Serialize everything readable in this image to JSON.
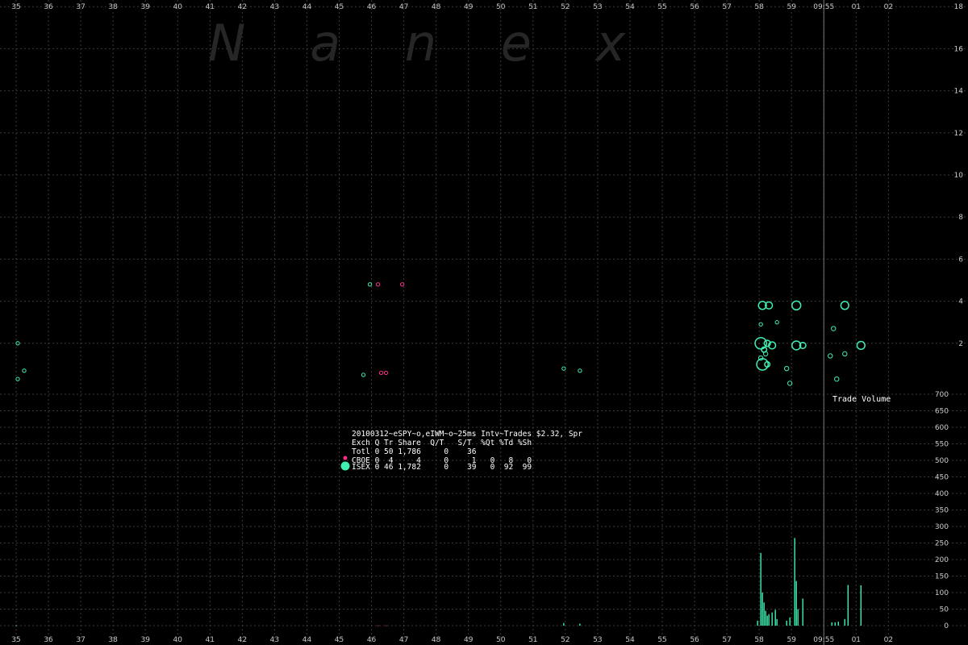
{
  "watermark": "N a n e x",
  "colors": {
    "background": "#000000",
    "grid": "#3a3a3a",
    "cboe": "#ff2d8a",
    "isex": "#40f0b0",
    "time_marker": "#777777",
    "text": "#ffffff"
  },
  "time_marker_label": "09:55",
  "stats": {
    "title": "20100312~eSPY~o,eIWM~o~25ms Intv~Trades $2.32, Spr",
    "header": "Exch Q Tr Share  Q/T   S/T  %Qt %Td %Sh",
    "rows": [
      {
        "name": "Totl",
        "text": "Totl 0 50 1,786     0    36"
      },
      {
        "name": "CBOE",
        "text": "CBOE 0  4     4     0     1   0   8   0",
        "color": "#ff2d8a"
      },
      {
        "name": "ISEX",
        "text": "ISEX 0 46 1,782     0    39   0  92  99",
        "color": "#40f0b0"
      }
    ]
  },
  "chart_data": [
    {
      "type": "scatter",
      "title": "",
      "xlabel": "",
      "ylabel": "",
      "x_ticks": [
        "35",
        "36",
        "37",
        "38",
        "39",
        "40",
        "41",
        "42",
        "43",
        "44",
        "45",
        "46",
        "47",
        "48",
        "49",
        "50",
        "51",
        "52",
        "53",
        "54",
        "55",
        "56",
        "57",
        "58",
        "59",
        "09:55",
        "01",
        "02"
      ],
      "y_ticks": [
        "18",
        "16",
        "14",
        "12",
        "10",
        "8",
        "6",
        "4",
        "2"
      ],
      "ylim": [
        0,
        18
      ],
      "grid": true,
      "series": [
        {
          "name": "CBOE",
          "color": "#ff2d8a",
          "points": [
            {
              "x": 46.2,
              "y": 4.8,
              "size": 1
            },
            {
              "x": 46.95,
              "y": 4.8,
              "size": 1
            },
            {
              "x": 46.3,
              "y": 0.6,
              "size": 1
            },
            {
              "x": 46.45,
              "y": 0.6,
              "size": 1
            }
          ]
        },
        {
          "name": "ISEX",
          "color": "#40f0b0",
          "points": [
            {
              "x": 35.05,
              "y": 2.0,
              "size": 1
            },
            {
              "x": 35.25,
              "y": 0.7,
              "size": 1
            },
            {
              "x": 35.05,
              "y": 0.3,
              "size": 1
            },
            {
              "x": 45.95,
              "y": 4.8,
              "size": 1
            },
            {
              "x": 45.75,
              "y": 0.5,
              "size": 1
            },
            {
              "x": 51.95,
              "y": 0.8,
              "size": 1
            },
            {
              "x": 52.45,
              "y": 0.7,
              "size": 1
            },
            {
              "x": 58.1,
              "y": 3.8,
              "size": 6
            },
            {
              "x": 58.3,
              "y": 3.8,
              "size": 5
            },
            {
              "x": 58.05,
              "y": 2.9,
              "size": 1
            },
            {
              "x": 58.05,
              "y": 2.0,
              "size": 10
            },
            {
              "x": 58.15,
              "y": 1.7,
              "size": 3
            },
            {
              "x": 58.25,
              "y": 2.0,
              "size": 4
            },
            {
              "x": 58.4,
              "y": 1.9,
              "size": 5
            },
            {
              "x": 58.2,
              "y": 1.5,
              "size": 2
            },
            {
              "x": 58.05,
              "y": 1.3,
              "size": 2
            },
            {
              "x": 58.1,
              "y": 1.0,
              "size": 10
            },
            {
              "x": 58.25,
              "y": 1.0,
              "size": 3
            },
            {
              "x": 58.55,
              "y": 3.0,
              "size": 1
            },
            {
              "x": 59.15,
              "y": 3.8,
              "size": 7
            },
            {
              "x": 59.15,
              "y": 1.9,
              "size": 7
            },
            {
              "x": 59.35,
              "y": 1.9,
              "size": 4
            },
            {
              "x": 58.85,
              "y": 0.8,
              "size": 2
            },
            {
              "x": 58.95,
              "y": 0.1,
              "size": 2
            },
            {
              "x": 60.65,
              "y": 3.8,
              "size": 6
            },
            {
              "x": 60.3,
              "y": 2.7,
              "size": 2
            },
            {
              "x": 61.15,
              "y": 1.9,
              "size": 6
            },
            {
              "x": 60.65,
              "y": 1.5,
              "size": 2
            },
            {
              "x": 60.2,
              "y": 1.4,
              "size": 2
            },
            {
              "x": 60.4,
              "y": 0.3,
              "size": 2
            }
          ]
        }
      ]
    },
    {
      "type": "bar",
      "title": "Trade Volume",
      "xlabel": "",
      "ylabel": "",
      "y_ticks": [
        "700",
        "650",
        "600",
        "550",
        "500",
        "450",
        "400",
        "350",
        "300",
        "250",
        "200",
        "150",
        "100",
        "50",
        "0"
      ],
      "ylim": [
        0,
        700
      ],
      "grid": true,
      "series": [
        {
          "name": "ISEX",
          "color": "#40f0b0",
          "bars": [
            {
              "x": 35.0,
              "v": 1
            },
            {
              "x": 51.95,
              "v": 8
            },
            {
              "x": 52.45,
              "v": 6
            },
            {
              "x": 57.95,
              "v": 15
            },
            {
              "x": 58.05,
              "v": 220
            },
            {
              "x": 58.1,
              "v": 100
            },
            {
              "x": 58.15,
              "v": 70
            },
            {
              "x": 58.2,
              "v": 45
            },
            {
              "x": 58.25,
              "v": 30
            },
            {
              "x": 58.3,
              "v": 35
            },
            {
              "x": 58.4,
              "v": 40
            },
            {
              "x": 58.5,
              "v": 48
            },
            {
              "x": 58.55,
              "v": 20
            },
            {
              "x": 58.85,
              "v": 15
            },
            {
              "x": 58.95,
              "v": 25
            },
            {
              "x": 59.1,
              "v": 265
            },
            {
              "x": 59.15,
              "v": 135
            },
            {
              "x": 59.2,
              "v": 50
            },
            {
              "x": 59.35,
              "v": 82
            },
            {
              "x": 60.25,
              "v": 10
            },
            {
              "x": 60.35,
              "v": 10
            },
            {
              "x": 60.45,
              "v": 12
            },
            {
              "x": 60.65,
              "v": 20
            },
            {
              "x": 60.75,
              "v": 123
            },
            {
              "x": 61.15,
              "v": 122
            }
          ]
        },
        {
          "name": "CBOE",
          "color": "#ff2d8a",
          "bars": [
            {
              "x": 46.2,
              "v": 1
            },
            {
              "x": 46.45,
              "v": 1
            }
          ]
        }
      ]
    }
  ]
}
